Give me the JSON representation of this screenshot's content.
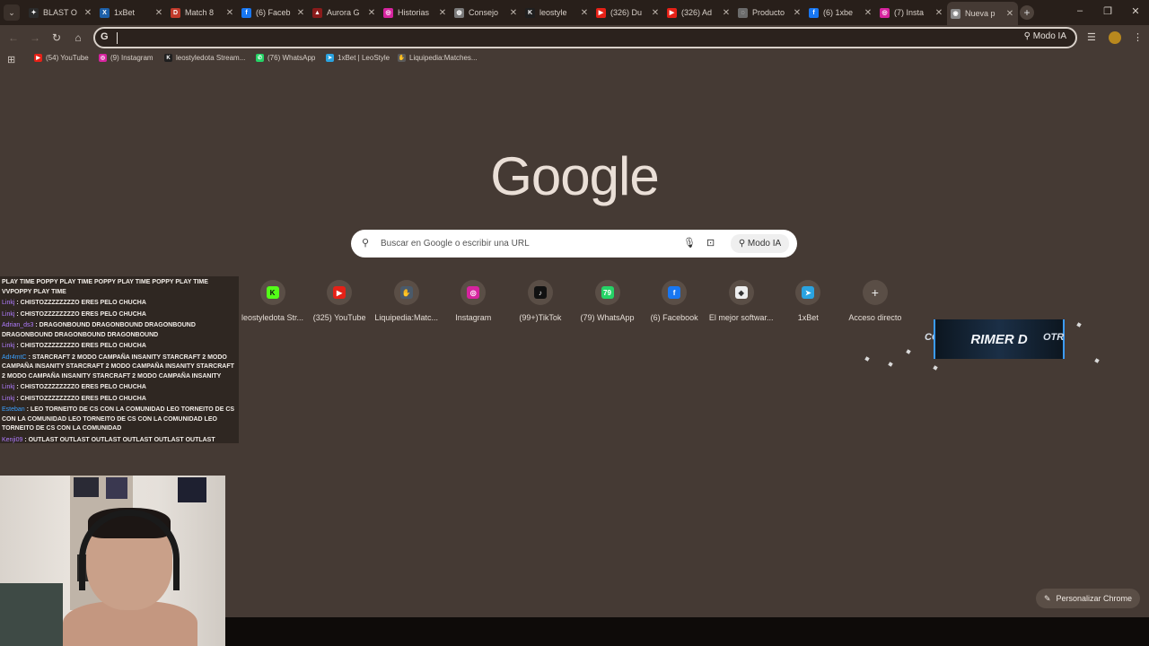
{
  "browser": {
    "tabs": [
      {
        "title": "BLAST O",
        "favicon": "blast-icon",
        "color": "#2b2b2b",
        "glyph": "✦"
      },
      {
        "title": "1xBet",
        "favicon": "1xbet-icon",
        "color": "#1c5fa8",
        "glyph": "X"
      },
      {
        "title": "Match 8",
        "favicon": "dotabuff-icon",
        "color": "#c23a2b",
        "glyph": "D"
      },
      {
        "title": "(6) Faceb",
        "favicon": "facebook-icon",
        "color": "#1877f2",
        "glyph": "f"
      },
      {
        "title": "Aurora G",
        "favicon": "aurora-icon",
        "color": "#8a1b1b",
        "glyph": "▲"
      },
      {
        "title": "Historias",
        "favicon": "instagram-icon",
        "color": "#d6249f",
        "glyph": "◎"
      },
      {
        "title": "Consejo",
        "favicon": "globe-icon",
        "color": "#7a7a7a",
        "glyph": "◍"
      },
      {
        "title": "leostyle",
        "favicon": "kick-icon",
        "color": "#1f1f1f",
        "glyph": "K"
      },
      {
        "title": "(326) Du",
        "favicon": "youtube-icon",
        "color": "#e62117",
        "glyph": "▶"
      },
      {
        "title": "(326) Ad",
        "favicon": "youtube-icon",
        "color": "#e62117",
        "glyph": "▶"
      },
      {
        "title": "Producto",
        "favicon": "chatgpt-icon",
        "color": "#6b6b6b",
        "glyph": "◌"
      },
      {
        "title": "(6) 1xbe",
        "favicon": "facebook-icon",
        "color": "#1877f2",
        "glyph": "f"
      },
      {
        "title": "(7) Insta",
        "favicon": "instagram-icon",
        "color": "#d6249f",
        "glyph": "◎"
      },
      {
        "title": "Nueva p",
        "favicon": "chrome-icon",
        "color": "#8a8a8a",
        "glyph": "◉"
      }
    ],
    "active_tab_index": 13,
    "omnibox": {
      "value": "",
      "modo_label": "Modo IA"
    },
    "bookmarks": [
      {
        "label": "(54) YouTube",
        "color": "#e62117",
        "glyph": "▶"
      },
      {
        "label": "(9) Instagram",
        "color": "#d6249f",
        "glyph": "◎"
      },
      {
        "label": "leostyledota Stream...",
        "color": "#1f1f1f",
        "glyph": "K"
      },
      {
        "label": "(76) WhatsApp",
        "color": "#25d366",
        "glyph": "✆"
      },
      {
        "label": "1xBet | LeoStyle",
        "color": "#2aa3e0",
        "glyph": "➤"
      },
      {
        "label": "Liquipedia:Matches...",
        "color": "#5a5a5a",
        "glyph": "✋"
      }
    ]
  },
  "newtab": {
    "logo": "Google",
    "search_placeholder": "Buscar en Google o escribir una URL",
    "modo_label": "Modo IA",
    "shortcuts": [
      {
        "label": "leostyledota Str...",
        "icon": "kick-icon",
        "color": "#53fc18",
        "glyph": "K",
        "fg": "#111"
      },
      {
        "label": "(325) YouTube",
        "icon": "youtube-icon",
        "color": "#e62117",
        "glyph": "▶",
        "fg": "#fff"
      },
      {
        "label": "Liquipedia:Matc...",
        "icon": "liquipedia-icon",
        "color": "#4a5a6a",
        "glyph": "✋",
        "fg": "#fff"
      },
      {
        "label": "Instagram",
        "icon": "instagram-icon",
        "color": "#d6249f",
        "glyph": "◎",
        "fg": "#fff"
      },
      {
        "label": "(99+)TikTok",
        "icon": "tiktok-icon",
        "color": "#111111",
        "glyph": "♪",
        "fg": "#fff"
      },
      {
        "label": "(79) WhatsApp",
        "icon": "whatsapp-icon",
        "color": "#25d366",
        "glyph": "79",
        "fg": "#fff"
      },
      {
        "label": "(6) Facebook",
        "icon": "facebook-icon",
        "color": "#1877f2",
        "glyph": "f",
        "fg": "#fff"
      },
      {
        "label": "El mejor softwar...",
        "icon": "software-icon",
        "color": "#eeeeee",
        "glyph": "◆",
        "fg": "#333"
      },
      {
        "label": "1xBet",
        "icon": "telegram-icon",
        "color": "#2aa3e0",
        "glyph": "➤",
        "fg": "#fff"
      },
      {
        "label": "Acceso directo",
        "icon": "plus-icon",
        "color": "transparent",
        "glyph": "+",
        "fg": "#eee"
      }
    ],
    "customize_label": "Personalizar Chrome"
  },
  "chat": [
    {
      "user": "",
      "user_color": "#ffffff",
      "text": "PLAY TIME POPPY PLAY TIME POPPY PLAY TIME POPPY PLAY TIME VVPOPPY PLAY TIME"
    },
    {
      "user": "Linkj",
      "user_color": "#b07cff",
      "text": ": CHISTOZZZZZZZZO ERES PELO CHUCHA"
    },
    {
      "user": "Linkj",
      "user_color": "#b07cff",
      "text": ": CHISTOZZZZZZZZO ERES PELO CHUCHA"
    },
    {
      "user": "Adrian_ds3",
      "user_color": "#b07cff",
      "text": ": DRAGONBOUND DRAGONBOUND DRAGONBOUND DRAGONBOUND DRAGONBOUND DRAGONBOUND"
    },
    {
      "user": "Linkj",
      "user_color": "#b07cff",
      "text": ": CHISTOZZZZZZZZO ERES PELO CHUCHA"
    },
    {
      "user": "Adr4mtC",
      "user_color": "#3aa0ff",
      "text": ": STARCRAFT 2 MODO CAMPAÑA INSANITY STARCRAFT 2 MODO CAMPAÑA INSANITY STARCRAFT 2 MODO CAMPAÑA INSANITY STARCRAFT 2 MODO CAMPAÑA INSANITY STARCRAFT 2 MODO CAMPAÑA INSANITY"
    },
    {
      "user": "Linkj",
      "user_color": "#b07cff",
      "text": ": CHISTOZZZZZZZZO ERES PELO CHUCHA"
    },
    {
      "user": "Linkj",
      "user_color": "#b07cff",
      "text": ": CHISTOZZZZZZZZO ERES PELO CHUCHA"
    },
    {
      "user": "Esteban",
      "user_color": "#3aa0ff",
      "text": ": LEO TORNEITO DE CS CON LA COMUNIDAD LEO TORNEITO DE CS CON LA COMUNIDAD LEO TORNEITO DE CS CON LA COMUNIDAD LEO TORNEITO DE CS CON LA COMUNIDAD"
    },
    {
      "user": "Kenji09",
      "user_color": "#b07cff",
      "text": ": OUTLAST OUTLAST OUTLAST OUTLAST OUTLAST OUTLAST"
    }
  ],
  "overlay_banner": {
    "left": "CO",
    "main": "RIMER D",
    "right": "OTR"
  }
}
